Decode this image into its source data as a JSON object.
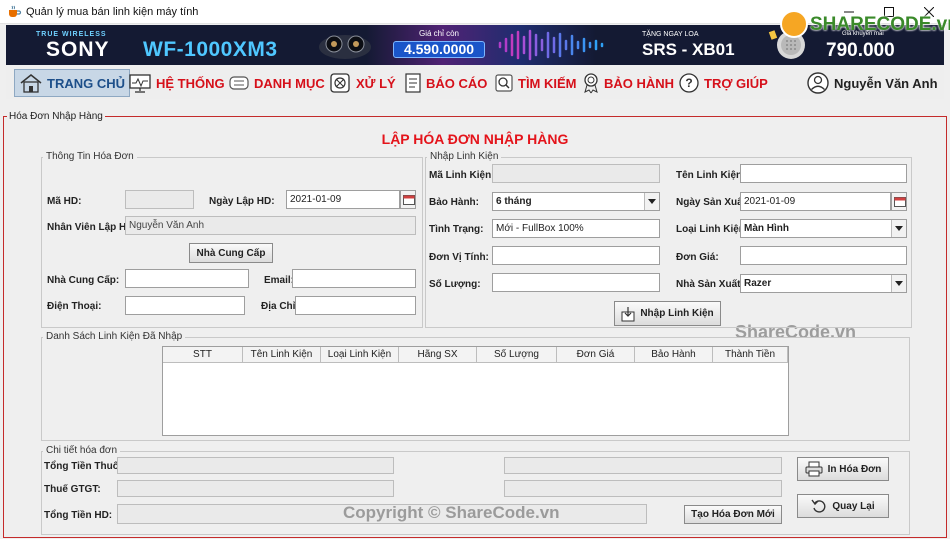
{
  "window": {
    "title": "Quản lý mua bán linh kiện máy tính"
  },
  "banner": {
    "tagline": "TRUE WIRELESS",
    "brand": "SONY",
    "model": "WF-1000XM3",
    "price_label": "Giá chỉ còn",
    "price": "4.590.0000",
    "gift_label": "TẶNG NGAY LOA",
    "gift_model": "SRS - XB01",
    "promo_label": "Giá khuyến mãi",
    "promo_price": "790.000"
  },
  "logo": {
    "text": "SHARECODE.vn"
  },
  "menu": {
    "items": [
      {
        "label": "TRANG CHỦ",
        "icon": "home-icon"
      },
      {
        "label": "HỆ THỐNG",
        "icon": "monitor-icon"
      },
      {
        "label": "DANH MỤC",
        "icon": "list-icon"
      },
      {
        "label": "XỬ LÝ",
        "icon": "process-icon"
      },
      {
        "label": "BÁO CÁO",
        "icon": "report-icon"
      },
      {
        "label": "TÌM KIẾM",
        "icon": "search-icon"
      },
      {
        "label": "BẢO HÀNH",
        "icon": "award-icon"
      },
      {
        "label": "TRỢ GIÚP",
        "icon": "help-icon"
      }
    ],
    "user": "Nguyễn Văn Anh"
  },
  "frame": {
    "title": "Hóa Đơn Nhập Hàng",
    "heading": "LẬP HÓA ĐƠN NHẬP HÀNG"
  },
  "invoice_info": {
    "title": "Thông Tin Hóa Đơn",
    "invoice_id_label": "Mã HD:",
    "invoice_id": "",
    "date_label": "Ngày Lập HD:",
    "date": "2021-01-09",
    "staff_label": "Nhân Viên Lập HD:",
    "staff": "Nguyễn Văn Anh",
    "supplier_button": "Nhà Cung Cấp",
    "supplier_label": "Nhà Cung Cấp:",
    "supplier": "",
    "email_label": "Email:",
    "email": "",
    "phone_label": "Điện Thoại:",
    "phone": "",
    "address_label": "Địa Chỉ:",
    "address": ""
  },
  "component_entry": {
    "title": "Nhập Linh Kiện",
    "code_label": "Mã Linh Kiện:",
    "code": "",
    "name_label": "Tên Linh Kiện:",
    "name": "",
    "warranty_label": "Bảo Hành:",
    "warranty": "6 tháng",
    "mfg_date_label": "Ngày Sản Xuất:",
    "mfg_date": "2021-01-09",
    "condition_label": "Tình Trạng:",
    "condition": "Mới - FullBox 100%",
    "type_label": "Loại Linh Kiện:",
    "type": "Màn Hình",
    "unit_label": "Đơn Vị Tính:",
    "unit": "",
    "price_label": "Đơn Giá:",
    "price": "",
    "qty_label": "Số Lượng:",
    "qty": "",
    "maker_label": "Nhà Sản Xuất:",
    "maker": "Razer",
    "add_button": "Nhập Linh Kiện"
  },
  "items_list": {
    "title": "Danh Sách Linh Kiện Đã Nhập",
    "columns": [
      "STT",
      "Tên Linh Kiện",
      "Loại Linh Kiện",
      "Hãng SX",
      "Số Lượng",
      "Đơn Giá",
      "Bảo Hành",
      "Thành Tiền"
    ]
  },
  "details": {
    "title": "Chi tiết hóa đơn",
    "total_label": "Tổng Tiền Thuốc:",
    "total": "",
    "vat_label": "Thuế GTGT:",
    "vat": "",
    "grand_total_label": "Tổng Tiền HD:",
    "grand_total": "",
    "extra_1": "",
    "extra_2": "",
    "print_button": "In Hóa Đơn",
    "back_button": "Quay Lại",
    "new_button": "Tạo Hóa Đơn Mới"
  },
  "watermarks": {
    "center": "ShareCode.vn",
    "bottom": "Copyright © ShareCode.vn"
  },
  "colors": {
    "accent_red": "#e4141b",
    "menu_red": "#d6101a",
    "banner_bg": "#141a33"
  }
}
